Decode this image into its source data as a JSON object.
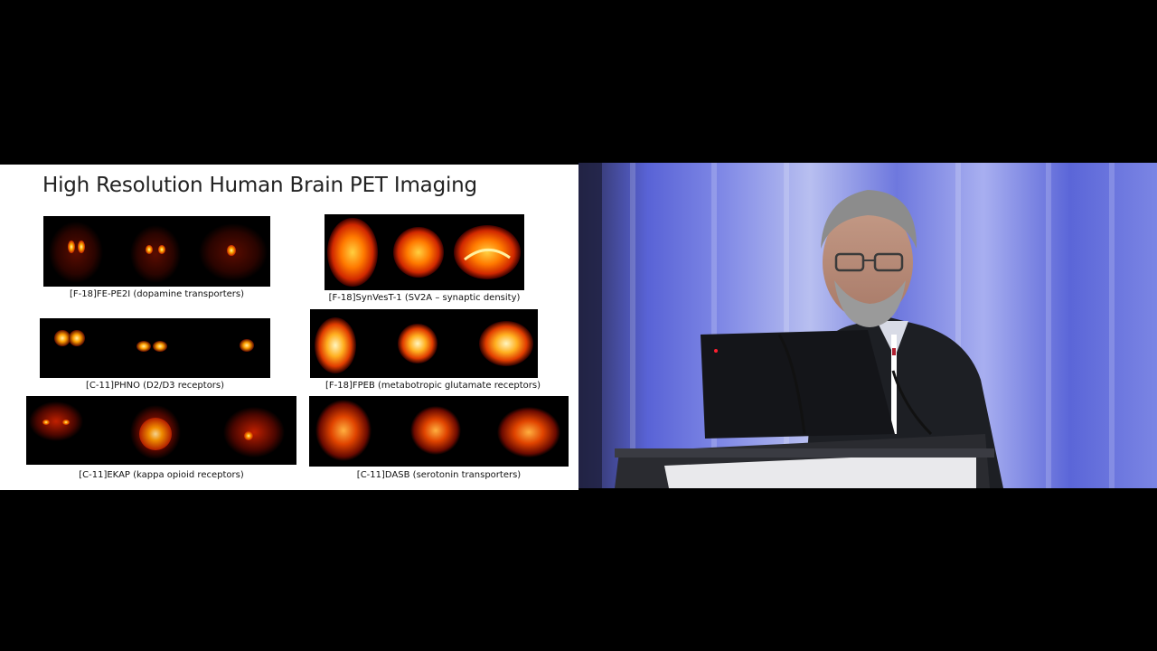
{
  "slide": {
    "title": "High Resolution Human Brain PET Imaging",
    "images": [
      {
        "caption": "[F-18]FE-PE2I (dopamine transporters)",
        "tracer": "dopamine-transporter-pet-scan"
      },
      {
        "caption": "[F-18]SynVesT-1 (SV2A – synaptic density)",
        "tracer": "synaptic-density-pet-scan"
      },
      {
        "caption": "[C-11]PHNO (D2/D3 receptors)",
        "tracer": "d2-d3-receptor-pet-scan"
      },
      {
        "caption": "[F-18]FPEB (metabotropic glutamate receptors)",
        "tracer": "glutamate-receptor-pet-scan"
      },
      {
        "caption": "[C-11]EKAP (kappa opioid receptors)",
        "tracer": "kappa-opioid-receptor-pet-scan"
      },
      {
        "caption": "[C-11]DASB (serotonin transporters)",
        "tracer": "serotonin-transporter-pet-scan"
      }
    ]
  },
  "camera": {
    "subject": "speaker-at-podium",
    "background_color": "#4a55c8"
  }
}
